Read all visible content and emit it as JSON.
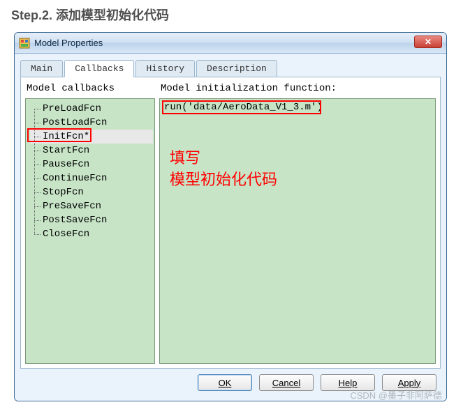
{
  "step_title": "Step.2. 添加模型初始化代码",
  "window": {
    "title": "Model Properties",
    "close_glyph": "✕"
  },
  "tabs": [
    "Main",
    "Callbacks",
    "History",
    "Description"
  ],
  "active_tab_index": 1,
  "tree": {
    "header": "Model callbacks",
    "items": [
      "PreLoadFcn",
      "PostLoadFcn",
      "InitFcn*",
      "StartFcn",
      "PauseFcn",
      "ContinueFcn",
      "StopFcn",
      "PreSaveFcn",
      "PostSaveFcn",
      "CloseFcn"
    ],
    "selected_index": 2
  },
  "code": {
    "header": "Model initialization function:",
    "content": "run('data/AeroData_V1_3.m')"
  },
  "annotation": "填写\n模型初始化代码",
  "buttons": {
    "ok": "OK",
    "cancel": "Cancel",
    "help": "Help",
    "apply": "Apply"
  },
  "watermark": "CSDN @墨子非阿萨德"
}
